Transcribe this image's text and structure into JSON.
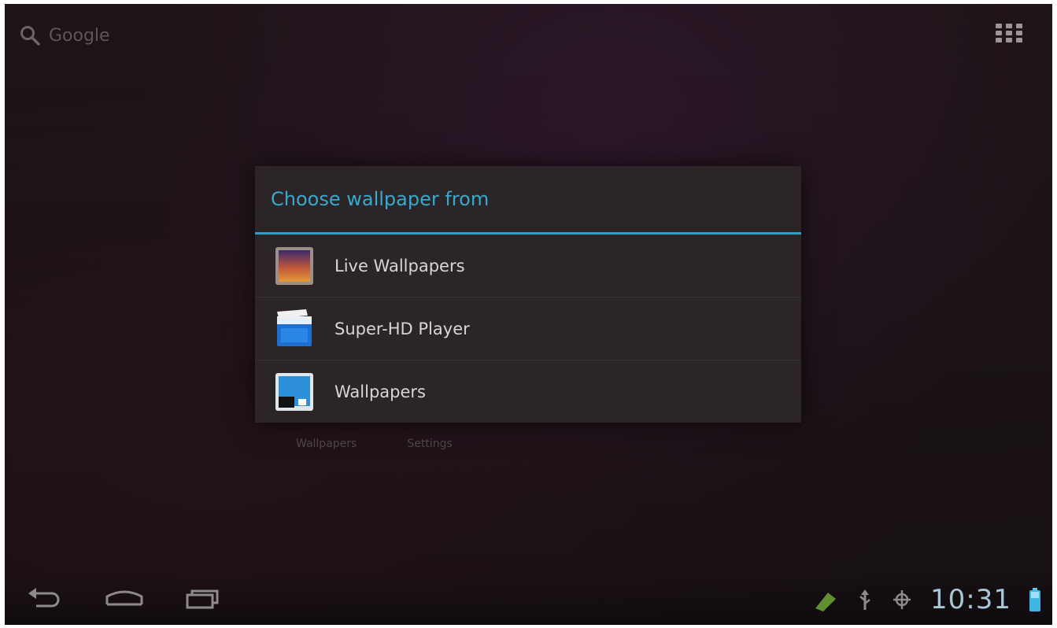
{
  "search": {
    "label": "Google"
  },
  "dialog": {
    "title": "Choose wallpaper from",
    "options": [
      {
        "label": "Live Wallpapers",
        "icon": "live-wallpapers-icon"
      },
      {
        "label": "Super-HD Player",
        "icon": "super-hd-player-icon"
      },
      {
        "label": "Wallpapers",
        "icon": "wallpapers-icon"
      }
    ]
  },
  "hints": {
    "left": "Wallpapers",
    "right": "Settings"
  },
  "statusbar": {
    "time": "10:31"
  },
  "colors": {
    "accent": "#2da0c3",
    "background": "#1a1216",
    "dialog": "#2b2527"
  }
}
